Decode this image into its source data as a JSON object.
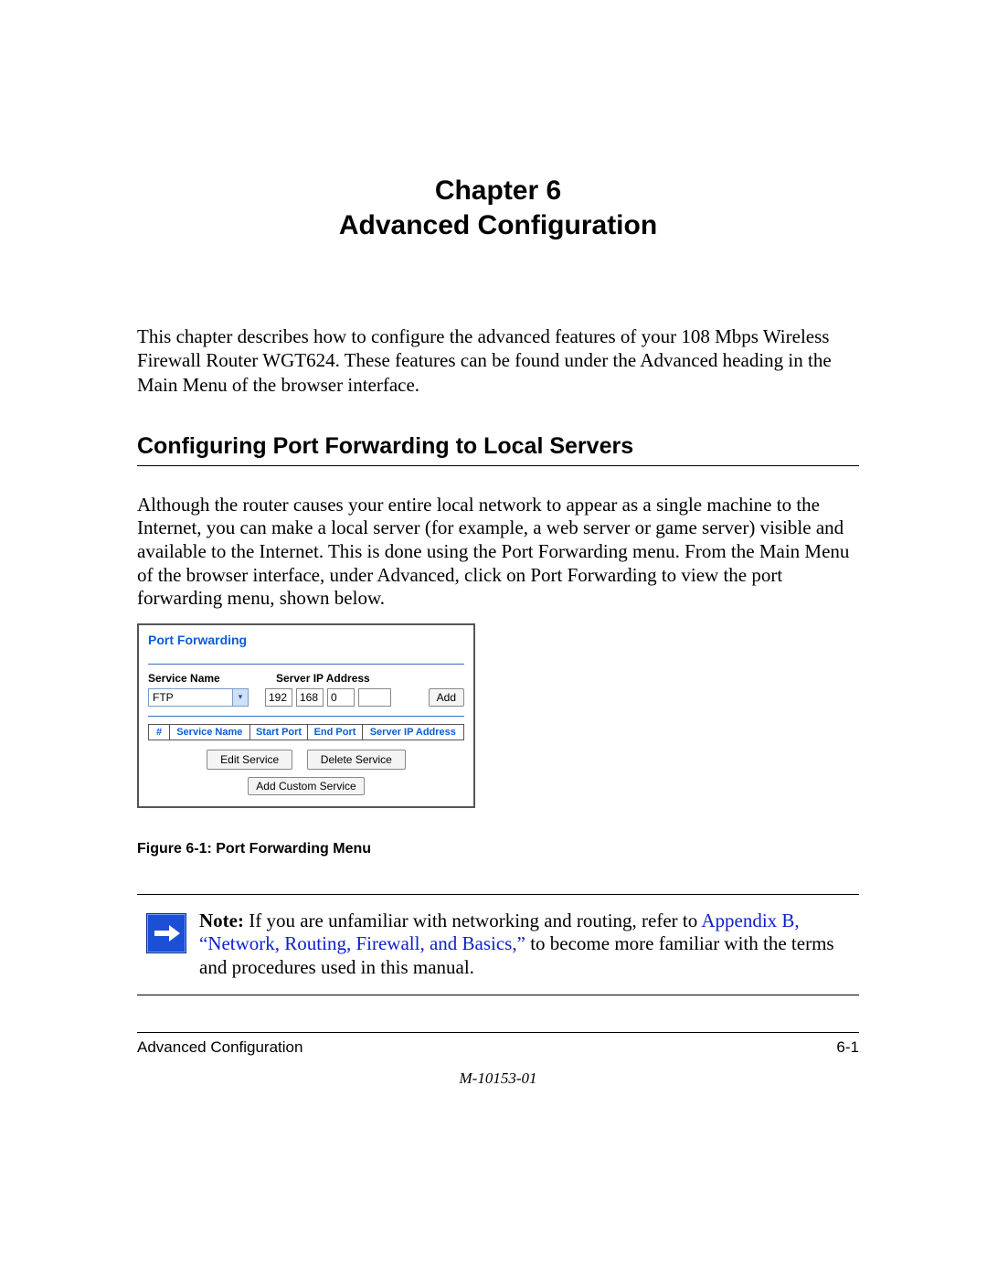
{
  "chapter": {
    "line1": "Chapter 6",
    "line2": "Advanced Configuration"
  },
  "intro": "This chapter describes how to configure the advanced features of your 108 Mbps Wireless Firewall Router WGT624. These features can be found under the Advanced heading in the Main Menu of the browser interface.",
  "section_heading": "Configuring Port Forwarding to Local Servers",
  "body1": "Although the router causes your entire local network to appear as a single machine to the Internet, you can make a local server (for example, a web server or game server) visible and available to the Internet. This is done using the Port Forwarding menu. From the Main Menu of the browser interface, under Advanced, click on Port Forwarding to view the port forwarding menu, shown below.",
  "pf": {
    "title": "Port Forwarding",
    "service_name_label": "Service Name",
    "server_ip_label": "Server IP Address",
    "service_selected": "FTP",
    "ip": {
      "o1": "192",
      "o2": "168",
      "o3": "0",
      "o4": ""
    },
    "add_btn": "Add",
    "cols": {
      "hash": "#",
      "name": "Service Name",
      "start": "Start Port",
      "end": "End Port",
      "ip": "Server IP Address"
    },
    "edit_btn": "Edit Service",
    "delete_btn": "Delete Service",
    "custom_btn": "Add Custom Service"
  },
  "figure_caption": "Figure 6-1:  Port Forwarding Menu",
  "note": {
    "label": "Note:",
    "pre": " If you are unfamiliar with networking and routing, refer to ",
    "link": "Appendix B, “Network, Routing, Firewall, and Basics,”",
    "post": " to become more familiar with the terms and procedures used in this manual."
  },
  "footer": {
    "left": "Advanced Configuration",
    "right": "6-1",
    "docnum": "M-10153-01"
  }
}
